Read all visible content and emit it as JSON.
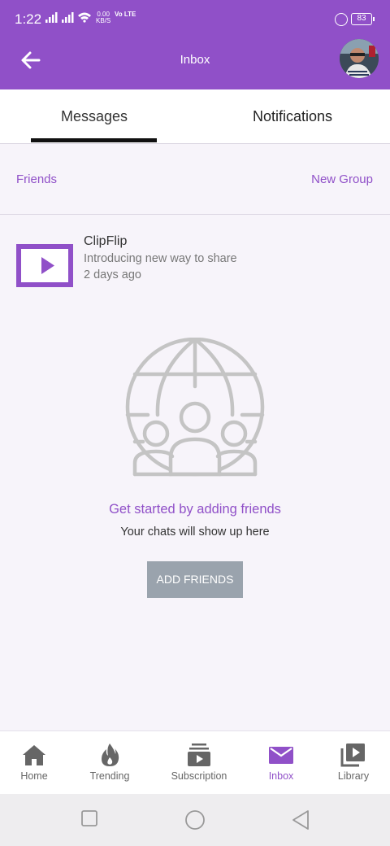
{
  "status": {
    "time": "1:22",
    "net_speed": "0.00",
    "net_unit": "KB/S",
    "volte": "Vo LTE",
    "battery": "83"
  },
  "appbar": {
    "title": "Inbox",
    "back_icon": "arrow-left-icon",
    "avatar_icon": "user-avatar"
  },
  "tabs": [
    {
      "label": "Messages",
      "active": true
    },
    {
      "label": "Notifications",
      "active": false
    }
  ],
  "links": {
    "friends": "Friends",
    "new_group": "New Group"
  },
  "message": {
    "sender": "ClipFlip",
    "snippet": "Introducing new way to share",
    "time": "2 days ago",
    "icon": "play-icon"
  },
  "empty_state": {
    "illustration": "globe-people-icon",
    "title": "Get started by adding friends",
    "subtitle": "Your chats will show up here",
    "button": "ADD FRIENDS"
  },
  "bottom_nav": [
    {
      "label": "Home",
      "icon": "home-icon",
      "active": false
    },
    {
      "label": "Trending",
      "icon": "flame-icon",
      "active": false
    },
    {
      "label": "Subscription",
      "icon": "subscription-icon",
      "active": false
    },
    {
      "label": "Inbox",
      "icon": "mail-icon",
      "active": true
    },
    {
      "label": "Library",
      "icon": "library-icon",
      "active": false
    }
  ],
  "colors": {
    "accent": "#9050c8",
    "button_gray": "#9aa3ad",
    "background": "#f7f4fa"
  }
}
